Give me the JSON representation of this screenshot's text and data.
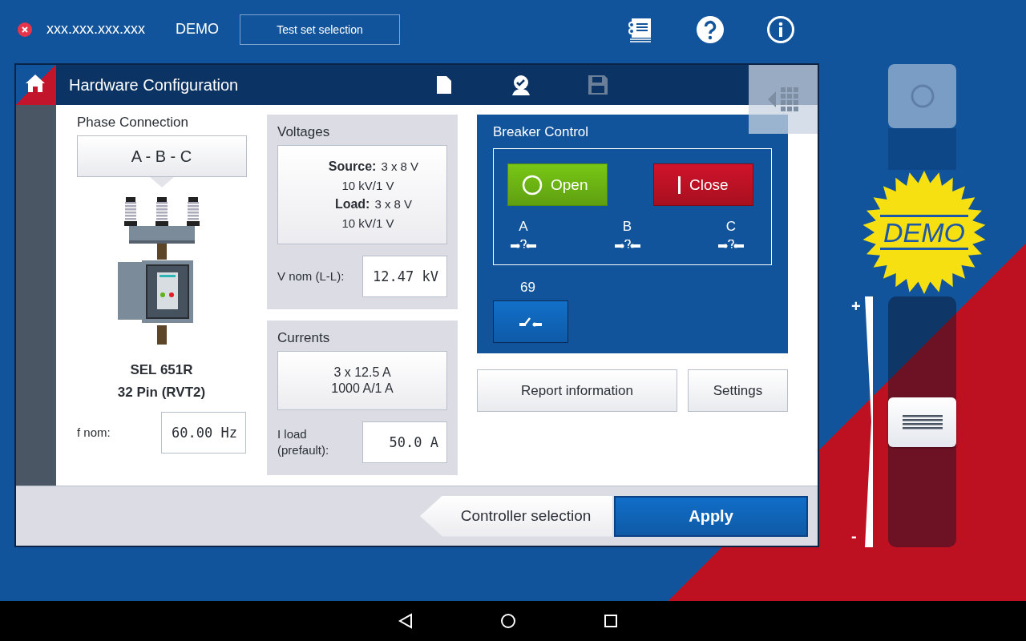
{
  "status_bar": {
    "connected": false,
    "address": "xxx.xxx.xxx.xxx",
    "mode": "DEMO",
    "test_set_button": "Test set selection"
  },
  "window": {
    "title": "Hardware Configuration",
    "toolbar": [
      {
        "kind": "file",
        "disabled": false
      },
      {
        "kind": "user",
        "disabled": false
      },
      {
        "kind": "save",
        "disabled": true
      }
    ]
  },
  "phase_connection": {
    "title": "Phase Connection",
    "value": "A - B - C"
  },
  "device": {
    "name": "SEL 651R",
    "wiring": "32 Pin (RVT2)"
  },
  "f_nom": {
    "label": "f nom:",
    "value": "60.00 Hz"
  },
  "voltages": {
    "title": "Voltages",
    "lines": [
      {
        "label": "Source:",
        "value": "3 x 8 V",
        "ratio": "10 kV/1 V"
      },
      {
        "label": "Load:",
        "value": "3 x 8 V",
        "ratio": "10 kV/1 V"
      }
    ],
    "nominal": {
      "label": "V nom (L-L):",
      "value": "12.47 kV"
    }
  },
  "currents": {
    "title": "Currents",
    "value": "3 x 12.5 A",
    "ratio": "1000 A/1 A",
    "load": {
      "label": "I load (prefault):",
      "value": "50.0 A"
    }
  },
  "breaker": {
    "title": "Breaker Control",
    "open_button": "Open",
    "close_button": "Close",
    "phases": [
      {
        "label": "A"
      },
      {
        "label": "B"
      },
      {
        "label": "C"
      }
    ],
    "recloser": {
      "label": "69"
    }
  },
  "actions": [
    "Report information",
    "Settings"
  ],
  "footer": {
    "back_button": "Controller selection",
    "apply_button": "Apply"
  },
  "side": {
    "demo_badge": "DEMO",
    "slider": {
      "plus": "+",
      "minus": "-",
      "level": 0.5
    }
  }
}
